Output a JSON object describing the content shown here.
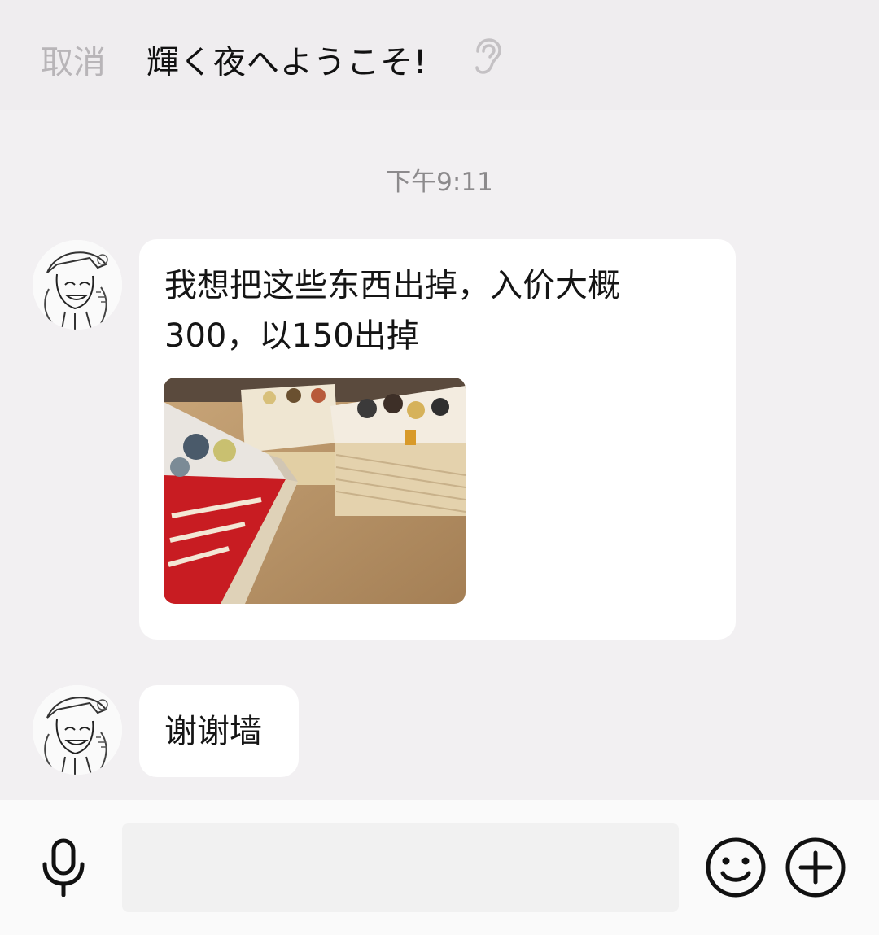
{
  "header": {
    "cancel_label": "取消",
    "title": "輝く夜へようこそ!",
    "ear_icon": "ear-icon"
  },
  "chat": {
    "timestamp": "下午9:11",
    "messages": [
      {
        "sender": "avatar",
        "lines": [
          "我想把这些东西出掉，入价大概",
          "300，以150出掉"
        ],
        "has_image": true,
        "image": "photo-of-manga-book-stacks"
      },
      {
        "sender": "avatar",
        "lines": [
          "谢谢墙"
        ],
        "has_image": false
      }
    ]
  },
  "input_bar": {
    "voice_icon": "microphone-icon",
    "emoji_icon": "smiley-icon",
    "plus_icon": "plus-icon",
    "placeholder": ""
  }
}
